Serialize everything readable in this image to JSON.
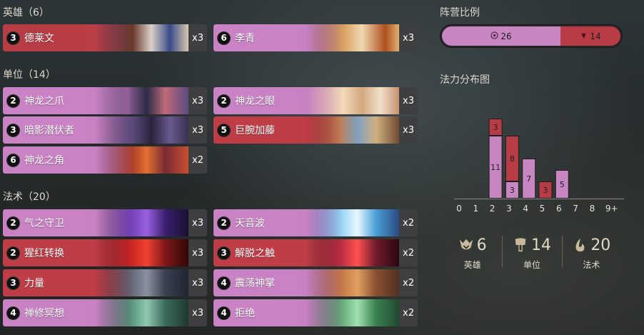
{
  "sections": {
    "champions": "英雄（6）",
    "units": "单位（14）",
    "spells": "法术（20）"
  },
  "cards": [
    {
      "cost": "3",
      "name": "德莱文",
      "count": "x3",
      "region": "champ",
      "art": "draven"
    },
    {
      "cost": "6",
      "name": "李青",
      "count": "x3",
      "region": "ionia",
      "art": "leesin"
    },
    {
      "cost": "2",
      "name": "神龙之爪",
      "count": "x3",
      "region": "ionia",
      "art": "claw"
    },
    {
      "cost": "2",
      "name": "神龙之眼",
      "count": "x3",
      "region": "ionia",
      "art": "eye"
    },
    {
      "cost": "3",
      "name": "暗影潜伏者",
      "count": "x3",
      "region": "ionia",
      "art": "shadow"
    },
    {
      "cost": "5",
      "name": "巨腕加藤",
      "count": "x3",
      "region": "noxus",
      "art": "kato"
    },
    {
      "cost": "6",
      "name": "神龙之角",
      "count": "x2",
      "region": "ionia",
      "art": "horn"
    },
    {
      "cost": "2",
      "name": "气之守卫",
      "count": "x3",
      "region": "ionia",
      "art": "guard"
    },
    {
      "cost": "2",
      "name": "天音波",
      "count": "x2",
      "region": "ionia",
      "art": "sonic"
    },
    {
      "cost": "2",
      "name": "猩红转换",
      "count": "x3",
      "region": "noxus",
      "art": "crimson"
    },
    {
      "cost": "3",
      "name": "解脱之触",
      "count": "x2",
      "region": "noxus",
      "art": "touch"
    },
    {
      "cost": "3",
      "name": "力量",
      "count": "x3",
      "region": "noxus",
      "art": "might"
    },
    {
      "cost": "4",
      "name": "震荡神掌",
      "count": "x2",
      "region": "ionia",
      "art": "palm"
    },
    {
      "cost": "4",
      "name": "禅修冥想",
      "count": "x3",
      "region": "ionia",
      "art": "meditate"
    },
    {
      "cost": "4",
      "name": "拒绝",
      "count": "x2",
      "region": "ionia",
      "art": "deny"
    }
  ],
  "region_ratio": {
    "title": "阵营比例",
    "ionia": {
      "value": "26",
      "icon": "ionia-icon"
    },
    "noxus": {
      "value": "14",
      "icon": "noxus-icon"
    }
  },
  "mana_chart_title": "法力分布图",
  "chart_data": {
    "type": "bar",
    "stacked": true,
    "categories": [
      "0",
      "1",
      "2",
      "3",
      "4",
      "5",
      "6",
      "7",
      "8",
      "9+"
    ],
    "series": [
      {
        "region": "ionia",
        "color": "#c786c2",
        "values": [
          0,
          0,
          11,
          3,
          7,
          0,
          5,
          0,
          0,
          0
        ]
      },
      {
        "region": "noxus",
        "color": "#b73c45",
        "values": [
          0,
          0,
          3,
          8,
          0,
          3,
          0,
          0,
          0,
          0
        ]
      }
    ]
  },
  "stats": [
    {
      "icon": "champion-icon",
      "value": "6",
      "label": "英雄"
    },
    {
      "icon": "unit-icon",
      "value": "14",
      "label": "单位"
    },
    {
      "icon": "spell-icon",
      "value": "20",
      "label": "法术"
    }
  ],
  "colors": {
    "ionia": "#c786c2",
    "noxus": "#b73c45",
    "gold": "#c8b99a"
  }
}
